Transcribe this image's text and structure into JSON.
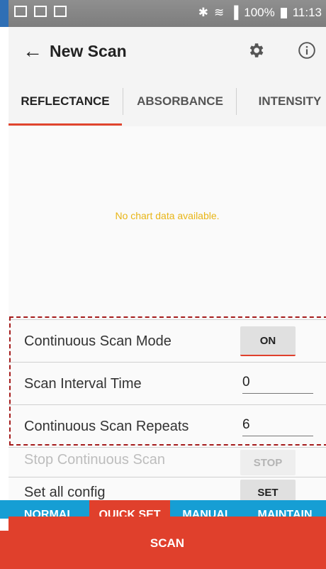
{
  "status_bar": {
    "battery": "100%",
    "time": "11:13"
  },
  "app_bar": {
    "title": "New Scan",
    "back_icon": "arrow-left-icon",
    "settings_icon": "gear-icon",
    "info_icon": "info-icon"
  },
  "tabs": [
    {
      "label": "REFLECTANCE",
      "active": true
    },
    {
      "label": "ABSORBANCE",
      "active": false
    },
    {
      "label": "INTENSITY",
      "active": false
    }
  ],
  "chart": {
    "empty_message": "No chart data available."
  },
  "settings": {
    "continuous_scan_mode": {
      "label": "Continuous Scan Mode",
      "button": "ON"
    },
    "scan_interval_time": {
      "label": "Scan Interval Time",
      "value": "0"
    },
    "continuous_scan_repeats": {
      "label": "Continuous Scan Repeats",
      "value": "6"
    },
    "stop_continuous_scan": {
      "label": "Stop Continuous Scan",
      "button": "STOP"
    },
    "set_all_config": {
      "label": "Set all config",
      "button": "SET"
    }
  },
  "bottom_nav": [
    {
      "label": "NORMAL",
      "active": false
    },
    {
      "label": "QUICK SET",
      "active": true
    },
    {
      "label": "MANUAL",
      "active": false
    },
    {
      "label": "MAINTAIN",
      "active": false
    }
  ],
  "scan_button": {
    "label": "SCAN"
  },
  "colors": {
    "accent": "#e0402c",
    "nav_blue": "#169ed4",
    "empty_text": "#e8b516"
  }
}
